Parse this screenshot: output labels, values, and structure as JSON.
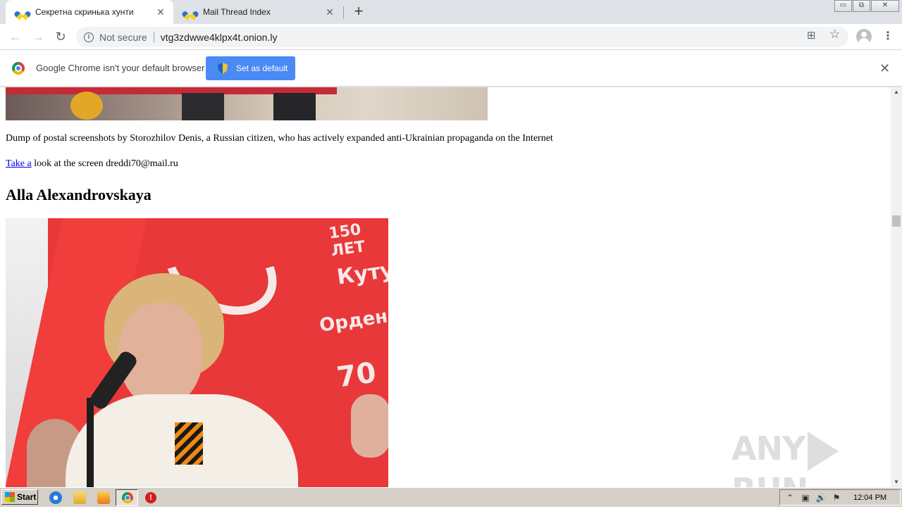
{
  "browser": {
    "tabs": [
      {
        "title": "Секретна скринька хунти",
        "active": true
      },
      {
        "title": "Mail Thread Index",
        "active": false
      }
    ],
    "new_tab_glyph": "+",
    "window_controls": {
      "minimize": "▭",
      "restore": "⧉",
      "close": "✕"
    },
    "address_bar": {
      "security_label": "Not secure",
      "url": "vtg3zdwwe4klpx4t.onion.ly"
    },
    "nav_glyphs": {
      "back": "←",
      "forward": "→",
      "reload": "↻"
    },
    "toolbar_glyphs": {
      "translate": "⊞",
      "bookmark": "☆",
      "menu": "⋮"
    }
  },
  "infobar": {
    "message": "Google Chrome isn't your default browser",
    "button_label": "Set as default",
    "close_glyph": "✕"
  },
  "page": {
    "caption": "Dump of postal screenshots by Storozhilov Denis, a Russian citizen, who has actively expanded anti-Ukrainian propaganda on the Internet",
    "link_text": "Take a",
    "link_rest": " look at the screen dreddi70@mail.ru",
    "person_heading": "Alla Alexandrovskaya",
    "flag_text": [
      "150 ЛЕТ",
      "Кутуз",
      "Ордена",
      "70"
    ]
  },
  "scrollbar": {
    "up_glyph": "▲",
    "down_glyph": "▼"
  },
  "watermark": {
    "left": "ANY",
    "right": "RUN"
  },
  "taskbar": {
    "start_label": "Start",
    "clock": "12:04 PM",
    "tray_glyphs": [
      "⌃",
      "▣",
      "🔊",
      "⚑"
    ]
  },
  "colors": {
    "tab_strip": "#dee1e6",
    "infobar_button": "#4a8af4",
    "link": "#0000ee",
    "flag_red": "#e8383a",
    "taskbar": "#d4d0c8"
  }
}
